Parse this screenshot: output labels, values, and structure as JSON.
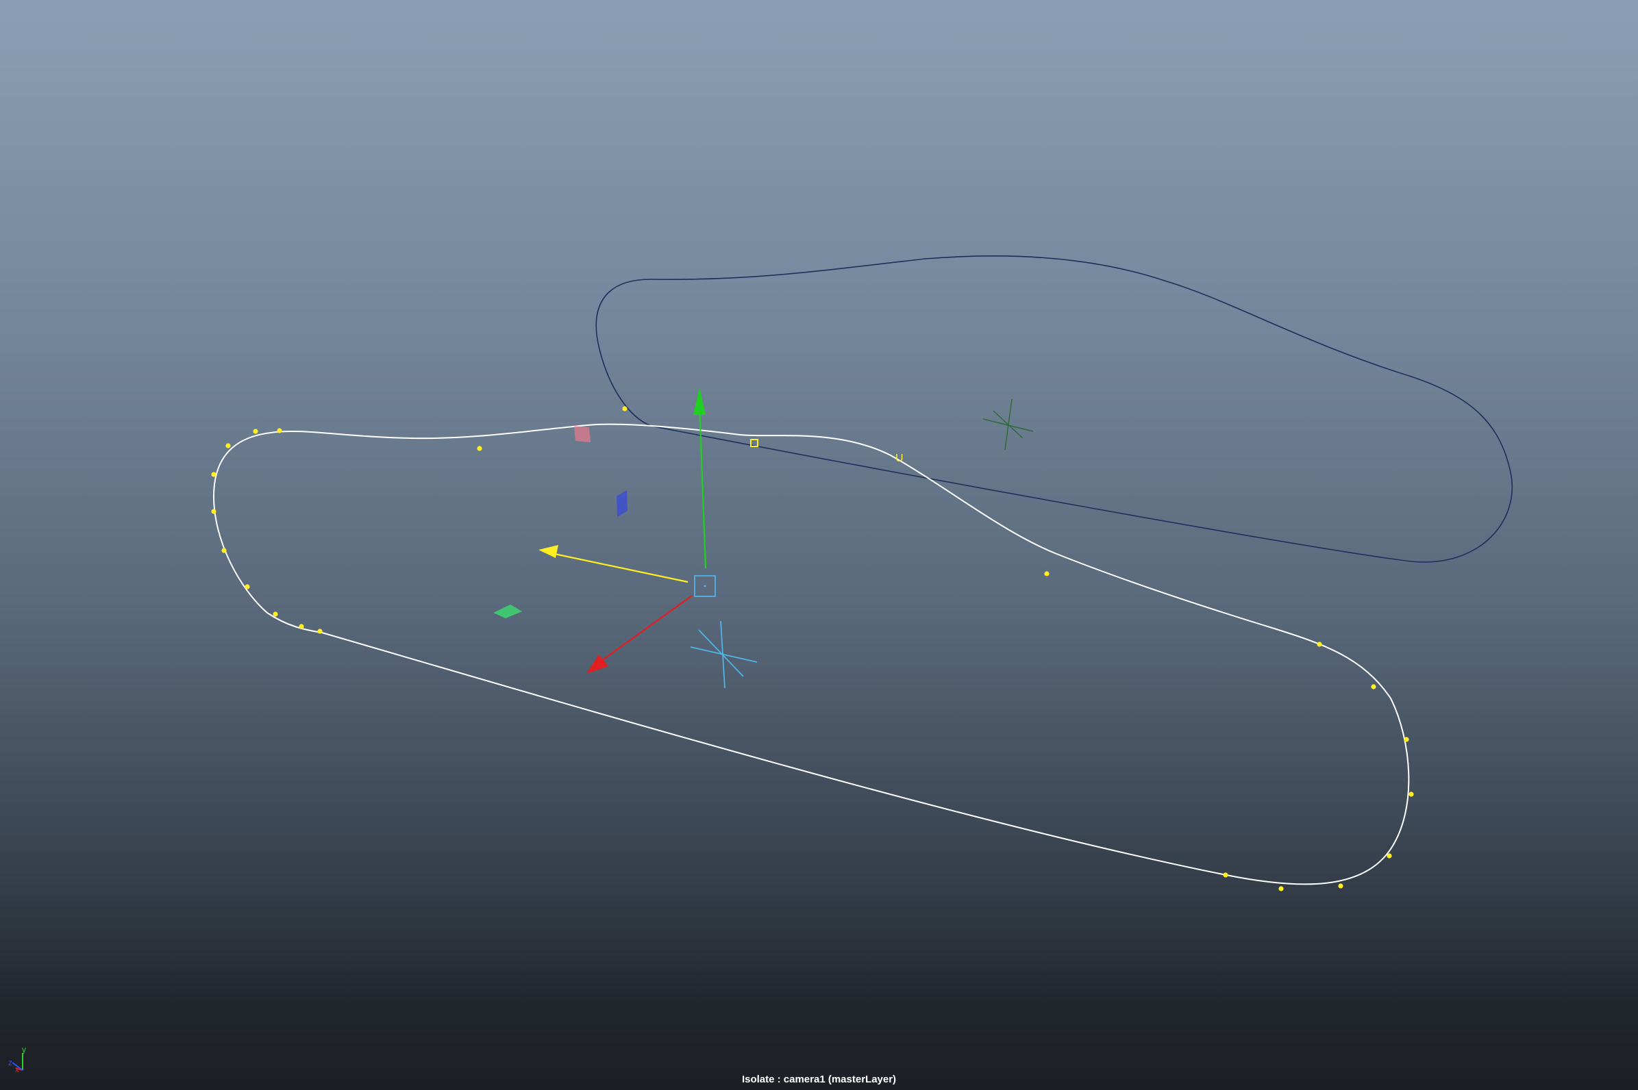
{
  "viewport": {
    "hud_text": "Isolate : camera1 (masterLayer)",
    "background_top": "#8a9fb5",
    "background_bottom": "#1c1f24"
  },
  "axis_indicator": {
    "y_label": "y",
    "x_label": "x",
    "z_label": "z",
    "colors": {
      "x": "#e02020",
      "y": "#30d030",
      "z": "#3050ff"
    }
  },
  "curves": {
    "selected_color": "#ffffff",
    "unselected_color": "#1f2e5a",
    "cv_color": "#ffee22"
  },
  "manipulator": {
    "x_color": "#e02020",
    "y_color": "#20d020",
    "z_color": "#ffee22",
    "center_color": "#4fb4e6",
    "plane_xy_color": "#ff7a8a",
    "plane_yz_color": "#3d4fcf",
    "plane_xz_color": "#3fcf6f"
  },
  "markers": {
    "u_label": "U",
    "locator_selected_color": "#4fb4e6",
    "locator_unselected_color": "#2e6b3a"
  }
}
